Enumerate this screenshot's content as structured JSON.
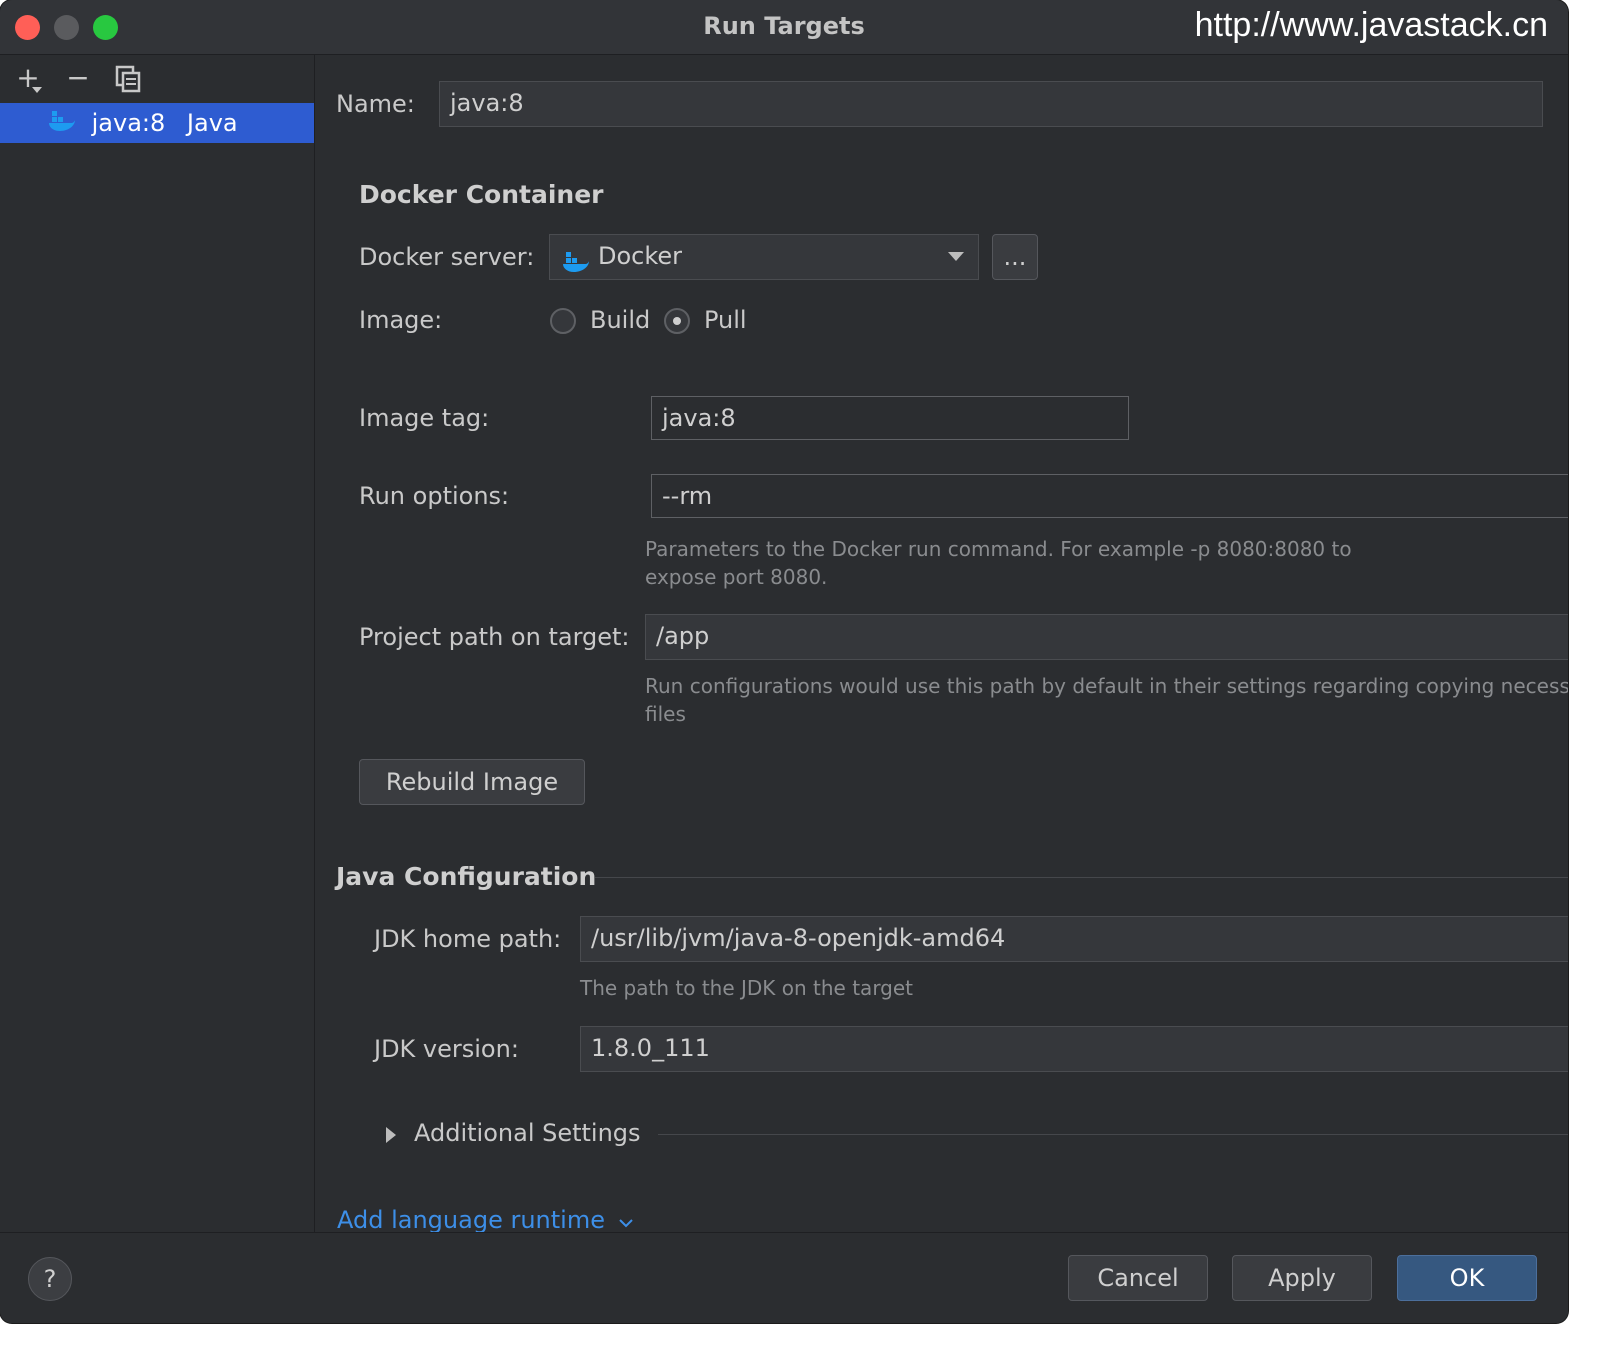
{
  "window": {
    "title": "Run Targets",
    "watermark": "http://www.javastack.cn"
  },
  "sidebar": {
    "toolbar": {
      "add": "+",
      "remove": "−"
    },
    "items": [
      {
        "name": "java:8",
        "type": "Java"
      }
    ]
  },
  "form": {
    "name_label": "Name:",
    "name_value": "java:8",
    "docker_section": "Docker Container",
    "docker_server_label": "Docker server:",
    "docker_server_value": "Docker",
    "browse_button": "...",
    "image_label": "Image:",
    "image_options": [
      {
        "label": "Build",
        "selected": false
      },
      {
        "label": "Pull",
        "selected": true
      }
    ],
    "image_tag_label": "Image tag:",
    "image_tag_value": "java:8",
    "run_options_label": "Run options:",
    "run_options_value": "--rm",
    "run_options_hint_1": "Parameters to the Docker run command. For example -p 8080:8080 to",
    "run_options_hint_2": "expose port 8080.",
    "project_path_label": "Project path on target:",
    "project_path_value": "/app",
    "project_path_hint_1": "Run configurations would use this path by default in their settings regarding copying necessa",
    "project_path_hint_2": "files",
    "rebuild_button": "Rebuild Image",
    "java_section": "Java Configuration",
    "jdk_home_label": "JDK home path:",
    "jdk_home_value": "/usr/lib/jvm/java-8-openjdk-amd64",
    "jdk_home_hint": "The path to the JDK on the target",
    "jdk_version_label": "JDK version:",
    "jdk_version_value": "1.8.0_111",
    "additional_settings": "Additional Settings",
    "add_runtime_link": "Add language runtime"
  },
  "footer": {
    "help": "?",
    "cancel": "Cancel",
    "apply": "Apply",
    "ok": "OK"
  },
  "colors": {
    "selection": "#2e5cd1",
    "link": "#3d8fe8",
    "primary_button": "#365880"
  }
}
